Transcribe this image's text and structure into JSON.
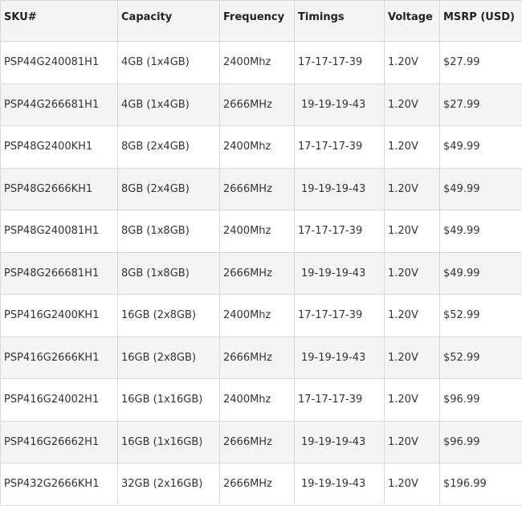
{
  "table": {
    "headers": [
      "SKU#",
      "Capacity",
      "Frequency",
      "Timings",
      "Voltage",
      "MSRP (USD)"
    ],
    "rows": [
      {
        "sku": "PSP44G240081H1",
        "capacity": "4GB (1x4GB)",
        "frequency": "2400Mhz",
        "timings": "17-17-17-39",
        "voltage": "1.20V",
        "msrp": "$27.99"
      },
      {
        "sku": "PSP44G266681H1",
        "capacity": "4GB (1x4GB)",
        "frequency": "2666MHz",
        "timings": "19-19-19-43",
        "voltage": "1.20V",
        "msrp": "$27.99"
      },
      {
        "sku": "PSP48G2400KH1",
        "capacity": "8GB (2x4GB)",
        "frequency": "2400Mhz",
        "timings": "17-17-17-39",
        "voltage": "1.20V",
        "msrp": "$49.99"
      },
      {
        "sku": "PSP48G2666KH1",
        "capacity": "8GB (2x4GB)",
        "frequency": "2666MHz",
        "timings": "19-19-19-43",
        "voltage": "1.20V",
        "msrp": "$49.99"
      },
      {
        "sku": "PSP48G240081H1",
        "capacity": "8GB (1x8GB)",
        "frequency": "2400Mhz",
        "timings": "17-17-17-39",
        "voltage": "1.20V",
        "msrp": "$49.99"
      },
      {
        "sku": "PSP48G266681H1",
        "capacity": "8GB (1x8GB)",
        "frequency": "2666MHz",
        "timings": "19-19-19-43",
        "voltage": "1.20V",
        "msrp": "$49.99"
      },
      {
        "sku": "PSP416G2400KH1",
        "capacity": "16GB (2x8GB)",
        "frequency": "2400Mhz",
        "timings": "17-17-17-39",
        "voltage": "1.20V",
        "msrp": "$52.99"
      },
      {
        "sku": "PSP416G2666KH1",
        "capacity": "16GB (2x8GB)",
        "frequency": "2666MHz",
        "timings": "19-19-19-43",
        "voltage": "1.20V",
        "msrp": "$52.99"
      },
      {
        "sku": "PSP416G24002H1",
        "capacity": "16GB (1x16GB)",
        "frequency": "2400Mhz",
        "timings": "17-17-17-39",
        "voltage": "1.20V",
        "msrp": "$96.99"
      },
      {
        "sku": "PSP416G26662H1",
        "capacity": "16GB (1x16GB)",
        "frequency": "2666MHz",
        "timings": "19-19-19-43",
        "voltage": "1.20V",
        "msrp": "$96.99"
      },
      {
        "sku": "PSP432G2666KH1",
        "capacity": "32GB (2x16GB)",
        "frequency": "2666MHz",
        "timings": "19-19-19-43",
        "voltage": "1.20V",
        "msrp": "$196.99"
      }
    ]
  }
}
